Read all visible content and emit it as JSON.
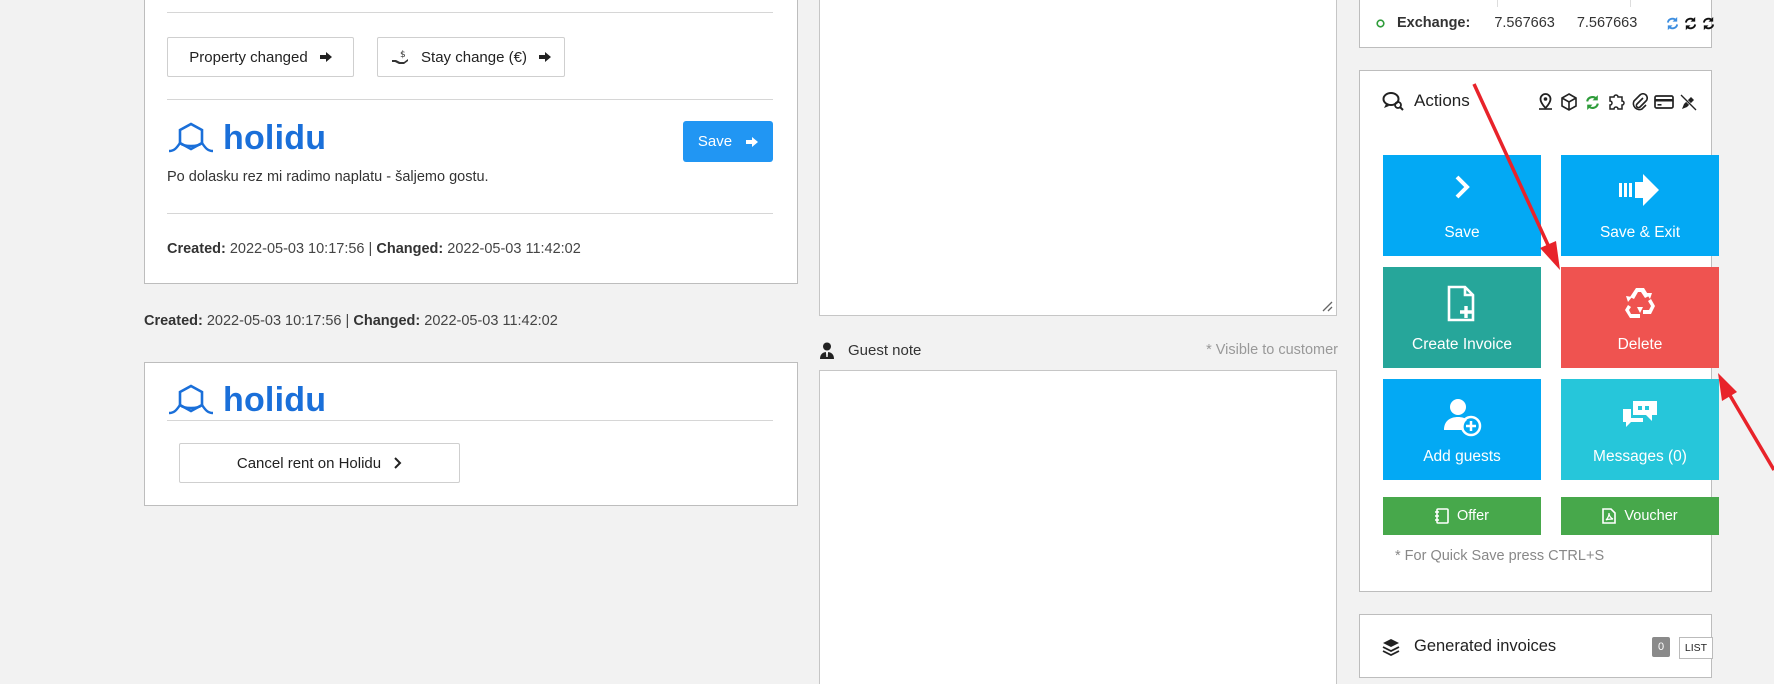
{
  "left": {
    "buttons": {
      "property_changed": "Property changed",
      "stay_change": "Stay change (€)"
    },
    "card1": {
      "brand": "holidu",
      "save_label": "Save",
      "note": "Po dolasku rez mi radimo naplatu - šaljemo gostu.",
      "created_label": "Created:",
      "created_value": "2022-05-03 10:17:56",
      "separator": "|",
      "changed_label": "Changed:",
      "changed_value": "2022-05-03 11:42:02"
    },
    "outer_meta": {
      "created_label": "Created:",
      "created_value": "2022-05-03 10:17:56",
      "separator": "|",
      "changed_label": "Changed:",
      "changed_value": "2022-05-03 11:42:02"
    },
    "card2": {
      "brand": "holidu",
      "cancel_label": "Cancel rent on Holidu"
    }
  },
  "middle": {
    "guest_note_label": "Guest note",
    "visible_hint": "* Visible to customer",
    "guest_note_value": ""
  },
  "right": {
    "exchange": {
      "label": "Exchange:",
      "value1": "7.567663",
      "value2": "7.567663"
    },
    "actions": {
      "title": "Actions",
      "header_icons": [
        "map-pin-icon",
        "cube-icon",
        "refresh-icon",
        "puzzle-icon",
        "paperclip-icon",
        "credit-card-icon",
        "pen-off-icon"
      ],
      "tiles": {
        "save": "Save",
        "save_exit": "Save & Exit",
        "create_invoice": "Create Invoice",
        "delete": "Delete",
        "add_guests": "Add guests",
        "messages": "Messages (0)",
        "offer": "Offer",
        "voucher": "Voucher"
      },
      "hint": "* For Quick Save press CTRL+S"
    },
    "generated_invoices": {
      "title": "Generated invoices",
      "count": "0",
      "list_label": "LIST"
    }
  },
  "colors": {
    "blue": "#03a9f4",
    "teal": "#26a69a",
    "red": "#ef5350",
    "cyan": "#26c6da",
    "green": "#47a84b",
    "brand": "#1a6fd9",
    "annotation_red": "#e8232a"
  }
}
